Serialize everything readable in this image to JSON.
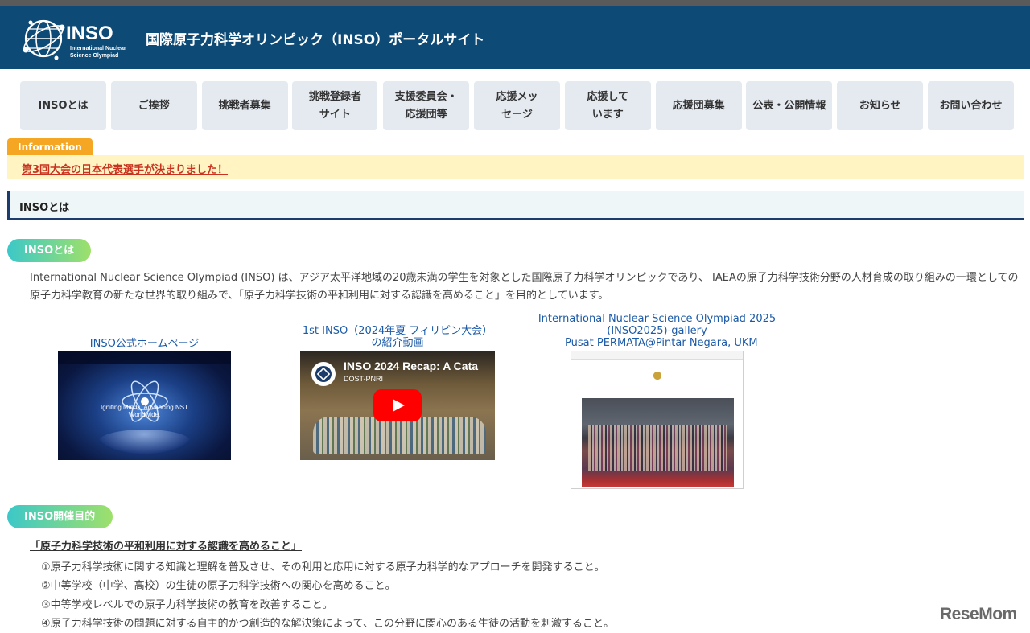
{
  "header": {
    "logo_word": "INSO",
    "logo_sub1": "International Nuclear",
    "logo_sub2": "Science Olympiad",
    "title": "国際原子力科学オリンピック（INSO）ポータルサイト"
  },
  "nav": {
    "items": [
      {
        "label": "INSOとは"
      },
      {
        "label": "ご挨拶"
      },
      {
        "label": "挑戦者募集"
      },
      {
        "label": "挑戦登録者サイト"
      },
      {
        "label": "支援委員会・応援団等"
      },
      {
        "label": "応援メッセージ"
      },
      {
        "label": "応援しています"
      },
      {
        "label": "応援団募集"
      },
      {
        "label": "公表・公開情報"
      },
      {
        "label": "お知らせ"
      },
      {
        "label": "お問い合わせ"
      }
    ]
  },
  "information": {
    "tab": "Information",
    "link": "第3回大会の日本代表選手が決まりました！"
  },
  "page_heading": "INSOとは",
  "about": {
    "pill": "INSOとは",
    "intro": "International Nuclear Science Olympiad (INSO) は、アジア太平洋地域の20歳未満の学生を対象とした国際原子力科学オリンピックであり、 IAEAの原子力科学技術分野の人材育成の取り組みの一環としての原子力科学教育の新たな世界的取り組みで、「原子力科学技術の平和利用に対する認識を高めること」を目的としています。"
  },
  "cards": [
    {
      "caption_lines": [
        "INSO公式ホームページ"
      ],
      "thumb_text_lines": [
        "Igniting Minds, Advancing NST",
        "Worldwide."
      ]
    },
    {
      "caption_lines": [
        "1st INSO（2024年夏 フィリピン大会）",
        "の紹介動画"
      ],
      "video_title": "INSO 2024 Recap: A Cata",
      "video_channel": "DOST-PNRI"
    },
    {
      "caption_lines": [
        "International Nuclear Science Olympiad 2025",
        "(INSO2025)-gallery",
        "– Pusat PERMATA@Pintar Negara, UKM"
      ]
    }
  ],
  "purpose": {
    "pill": "INSO開催目的",
    "quote": "「原子力科学技術の平和利用に対する認識を高めること」",
    "items": [
      "①原子力科学技術に関する知識と理解を普及させ、その利用と応用に対する原子力科学的なアプローチを開発すること。",
      "②中等学校（中学、高校）の生徒の原子力科学技術への関心を高めること。",
      "③中等学校レベルでの原子力科学技術の教育を改善すること。",
      "④原子力科学技術の問題に対する自主的かつ創造的な解決策によって、この分野に関心のある生徒の活動を刺激すること。"
    ]
  },
  "watermark": "ReseMom",
  "colors": {
    "header_bg": "#0d4a76",
    "nav_bg": "#e5eaf0",
    "info_tab": "#f5a623",
    "info_bg": "#fff4c2",
    "info_link": "#c8321e",
    "link": "#1a5aa8",
    "pill_start": "#3cc8c8",
    "pill_end": "#9ee06a"
  }
}
